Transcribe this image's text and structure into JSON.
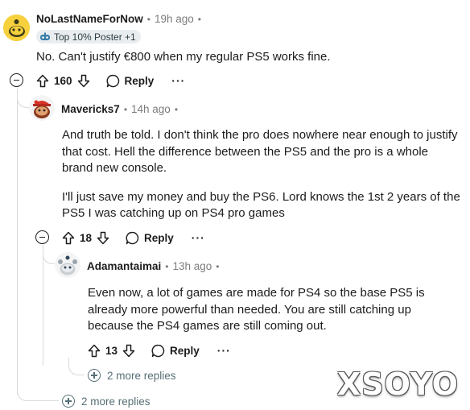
{
  "comments": [
    {
      "username": "NoLastNameForNow",
      "time": "19h ago",
      "flair": "Top 10% Poster +1",
      "body": [
        "No. Can't justify €800 when my regular PS5 works fine."
      ],
      "votes": "160",
      "reply_label": "Reply",
      "avatar_icon": "snoo-yellow-avatar"
    },
    {
      "username": "Mavericks7",
      "time": "14h ago",
      "body": [
        "And truth be told. I don't think the pro does nowhere near enough to justify that cost. Hell the difference between the PS5 and the pro is a whole brand new console.",
        "I'll just save my money and buy the PS6. Lord knows the 1st 2 years of the PS5 I was catching up on PS4 pro games"
      ],
      "votes": "18",
      "reply_label": "Reply",
      "avatar_icon": "snoo-red-hat-avatar"
    },
    {
      "username": "Adamantaimai",
      "time": "13h ago",
      "body": [
        "Even now, a lot of games are made for PS4 so the base PS5 is already more powerful than needed. You are still catching up because the PS4 games are still coming out."
      ],
      "votes": "13",
      "reply_label": "Reply",
      "avatar_icon": "snoo-grey-avatar"
    }
  ],
  "more_replies_inner": "2 more replies",
  "more_replies_outer": "2 more replies",
  "watermark": "XSOYO",
  "more_icon": "ellipsis-icon",
  "colors": {
    "meta_gray": "#7c7c7c",
    "thread_line": "#d7dadc",
    "flair_bg": "#eaedef",
    "more_replies_text": "#576f76"
  }
}
